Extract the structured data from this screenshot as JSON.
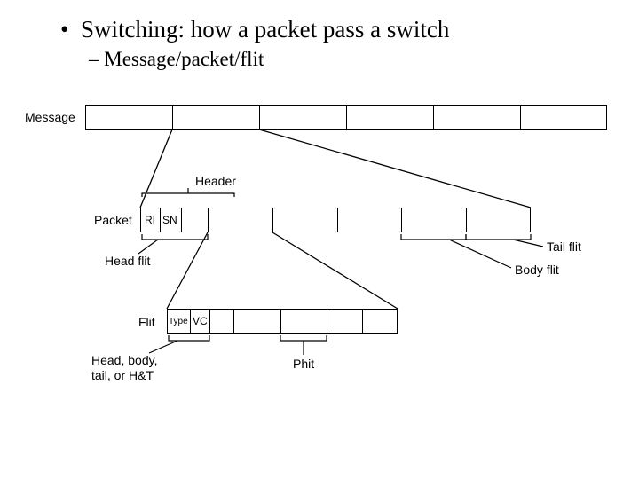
{
  "title": {
    "main": "Switching: how a packet pass a switch",
    "sub": "Message/packet/flit"
  },
  "diagram": {
    "message_label": "Message",
    "packet_label": "Packet",
    "flit_label": "Flit",
    "header_label": "Header",
    "head_flit_label": "Head flit",
    "body_flit_label": "Body flit",
    "tail_flit_label": "Tail flit",
    "phit_label": "Phit",
    "head_body_label": "Head, body,\ntail, or H&T",
    "ri_label": "RI",
    "sn_label": "SN",
    "type_label": "Type",
    "vc_label": "VC"
  }
}
